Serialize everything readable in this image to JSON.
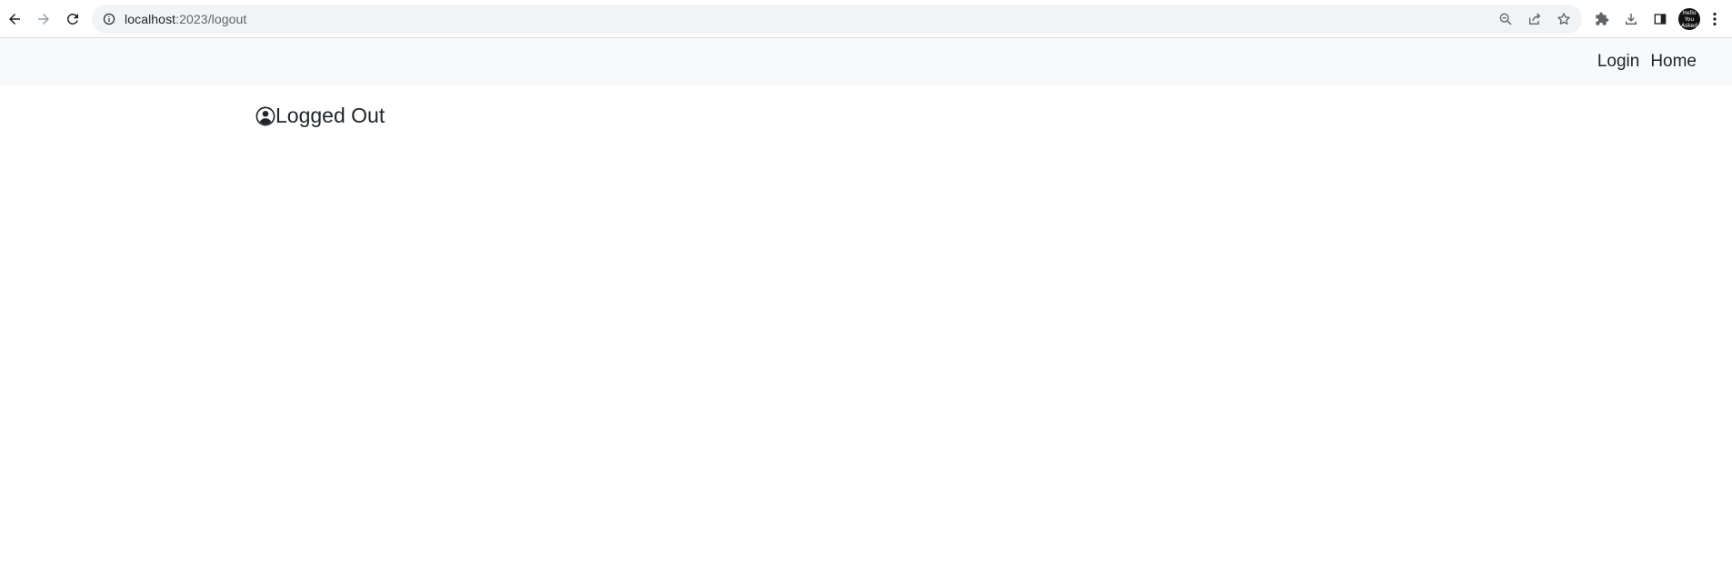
{
  "browser": {
    "url_host": "localhost",
    "url_path": ":2023/logout",
    "avatar_text": "Hello You Asked"
  },
  "navbar": {
    "links": [
      {
        "label": "Login"
      },
      {
        "label": "Home"
      }
    ]
  },
  "main": {
    "title": "Logged Out"
  }
}
